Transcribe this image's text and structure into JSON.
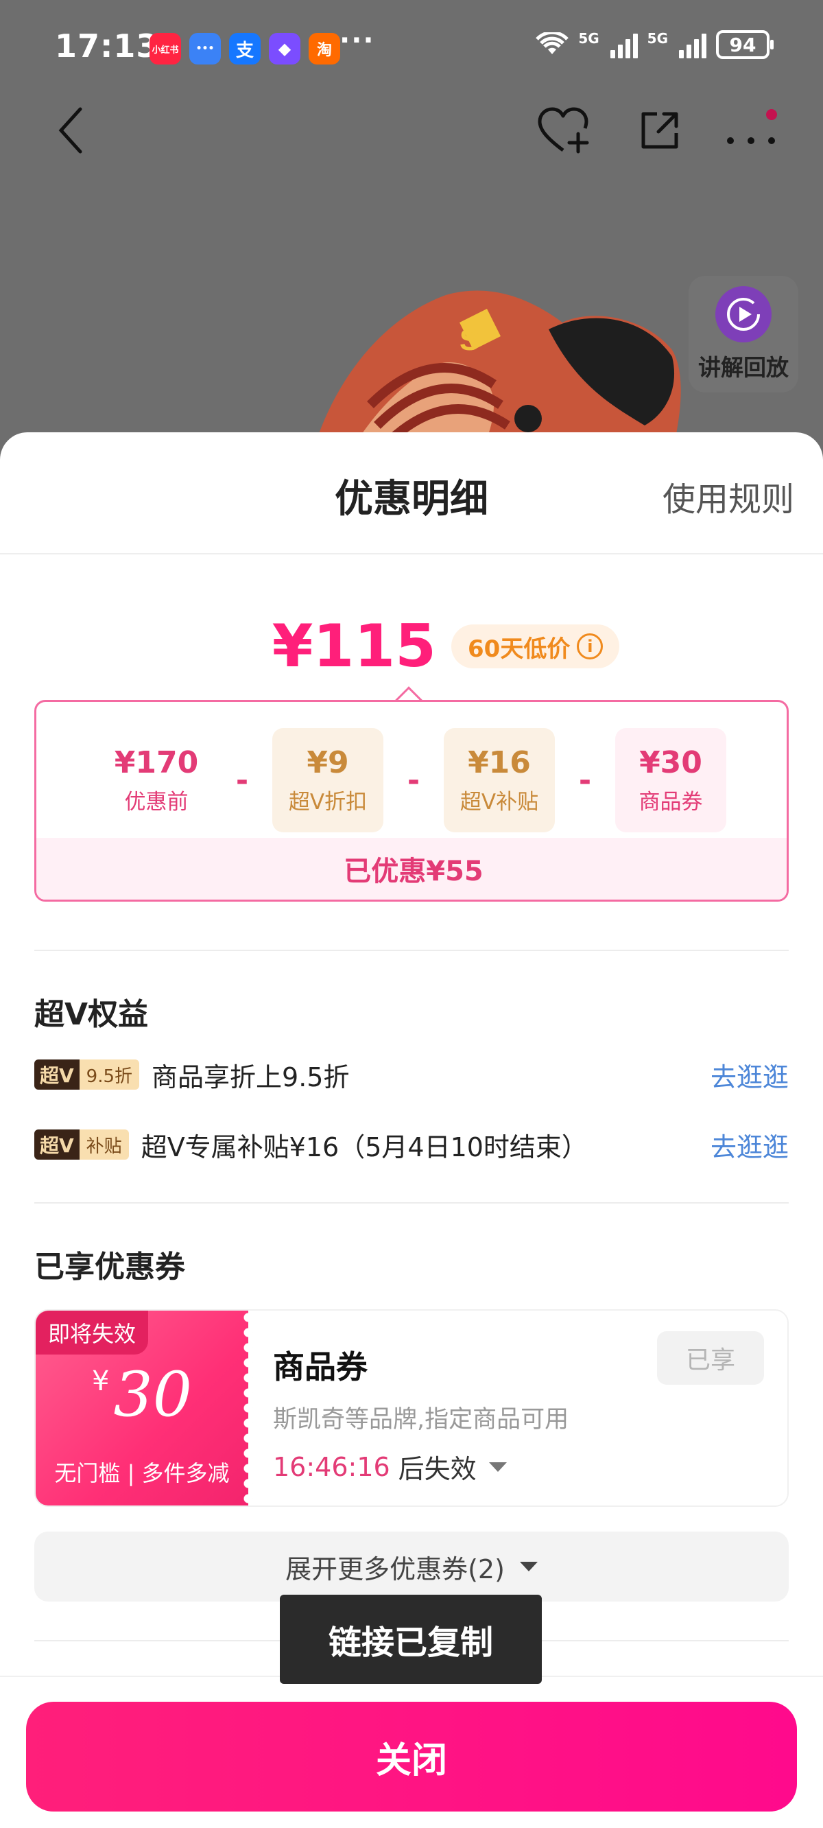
{
  "status_bar": {
    "time": "17:13",
    "apps": [
      {
        "name": "xiaohongshu-icon",
        "label": "小红书",
        "color": "#ff2442"
      },
      {
        "name": "messages-icon",
        "label": "•••",
        "color": "#3b82f6"
      },
      {
        "name": "alipay-icon",
        "label": "支",
        "color": "#1677ff"
      },
      {
        "name": "app-diamond-icon",
        "label": "◆",
        "color": "#7b4dff"
      },
      {
        "name": "taobao-icon",
        "label": "淘",
        "color": "#ff6a00"
      }
    ],
    "more": "···",
    "network_1": "5G",
    "network_2": "5G",
    "battery": "94"
  },
  "replay": {
    "label": "讲解回放"
  },
  "sheet": {
    "title": "优惠明细",
    "rules_link": "使用规则",
    "final_price": "¥115",
    "low_price_badge": "60天低价",
    "breakdown": {
      "original": {
        "amount": "¥170",
        "label": "优惠前"
      },
      "vip_discount": {
        "amount": "¥9",
        "label": "超V折扣"
      },
      "vip_subsidy": {
        "amount": "¥16",
        "label": "超V补贴"
      },
      "coupon": {
        "amount": "¥30",
        "label": "商品券"
      },
      "minus": "-",
      "saved": "已优惠¥55"
    },
    "vip_section": {
      "title": "超V权益",
      "rows": [
        {
          "tag_a": "超V",
          "tag_b": "9.5折",
          "text": "商品享折上9.5折",
          "link": "去逛逛"
        },
        {
          "tag_a": "超V",
          "tag_b": "补贴",
          "text": "超V专属补贴¥16（5月4日10时结束）",
          "link": "去逛逛"
        }
      ]
    },
    "coupon_section": {
      "title": "已享优惠券",
      "coupon": {
        "expiring_tag": "即将失效",
        "currency": "¥",
        "amount": "30",
        "condition": "无门槛 | 多件多减",
        "name": "商品券",
        "badge": "已享",
        "desc": "斯凯奇等品牌,指定商品可用",
        "countdown": "16:46:16",
        "countdown_suffix": "后失效"
      },
      "expand_label": "展开更多优惠券(2)"
    },
    "toast": "链接已复制",
    "close_button": "关闭"
  },
  "colors": {
    "accent": "#ff1f7a",
    "vip_gold": "#c98a3a",
    "link_blue": "#4c86d8",
    "low_price_orange": "#f08a1d"
  }
}
